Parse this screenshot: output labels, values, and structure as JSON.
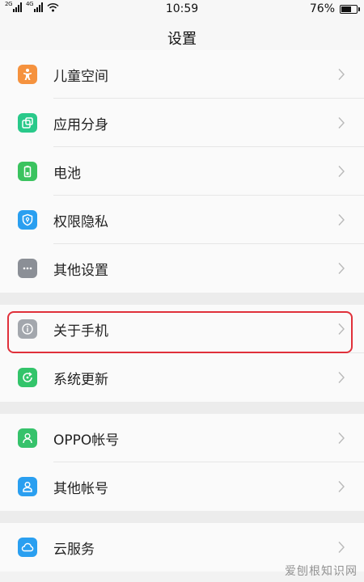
{
  "status_bar": {
    "sim1_tag": "2G",
    "sim2_tag": "4G",
    "time": "10:59",
    "battery_text": "76%",
    "battery_level": 0.76
  },
  "header": {
    "title": "设置"
  },
  "groups": [
    [
      {
        "label": "儿童空间",
        "icon": "child-icon",
        "color": "#f5923e"
      },
      {
        "label": "应用分身",
        "icon": "app-clone-icon",
        "color": "#29c98a"
      },
      {
        "label": "电池",
        "icon": "battery-icon",
        "color": "#3bc35f"
      },
      {
        "label": "权限隐私",
        "icon": "privacy-shield-icon",
        "color": "#2a9ff0"
      },
      {
        "label": "其他设置",
        "icon": "more-dots-icon",
        "color": "#8b8f96"
      }
    ],
    [
      {
        "label": "关于手机",
        "icon": "info-icon",
        "color": "#a3a7ad"
      },
      {
        "label": "系统更新",
        "icon": "system-update-icon",
        "color": "#33c46a"
      }
    ],
    [
      {
        "label": "OPPO帐号",
        "icon": "account-icon",
        "color": "#36c26b"
      },
      {
        "label": "其他帐号",
        "icon": "other-account-icon",
        "color": "#2a9ff0"
      }
    ],
    [
      {
        "label": "云服务",
        "icon": "cloud-icon",
        "color": "#2a9ff0"
      }
    ]
  ],
  "watermark": "爱刨根知识网"
}
